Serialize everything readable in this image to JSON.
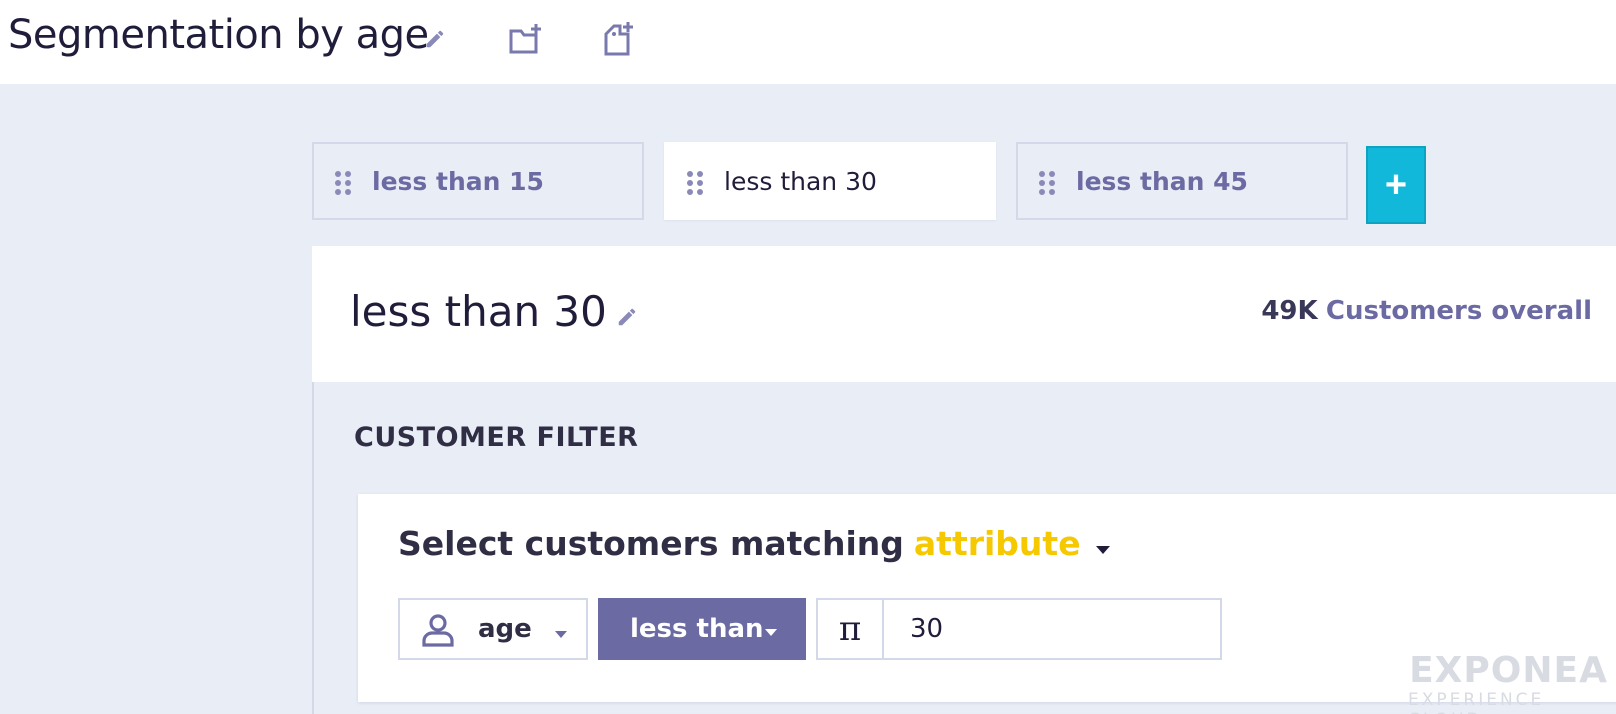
{
  "page": {
    "title": "Segmentation by age"
  },
  "tabs": [
    {
      "label": "less than 15",
      "active": false
    },
    {
      "label": "less than 30",
      "active": true
    },
    {
      "label": "less than 45",
      "active": false
    }
  ],
  "add_button": {
    "label": "+"
  },
  "segment": {
    "title": "less than 30",
    "count": "49K",
    "count_label": "Customers overall"
  },
  "filter": {
    "section_title": "CUSTOMER FILTER",
    "sentence": "Select customers matching",
    "mode": "attribute",
    "attribute": "age",
    "operator": "less than",
    "value_type_symbol": "π",
    "value": "30"
  },
  "brand": {
    "name": "EXPONEA",
    "subtitle": "EXPERIENCE CLOUD"
  },
  "colors": {
    "accent": "#6b6aa3",
    "cyan": "#12b8d9",
    "highlight": "#f5c800",
    "background": "#e9edf6"
  },
  "icons": [
    "pencil-icon",
    "folder-add-icon",
    "tag-add-icon",
    "drag-grip-icon",
    "user-icon",
    "caret-down-icon"
  ]
}
